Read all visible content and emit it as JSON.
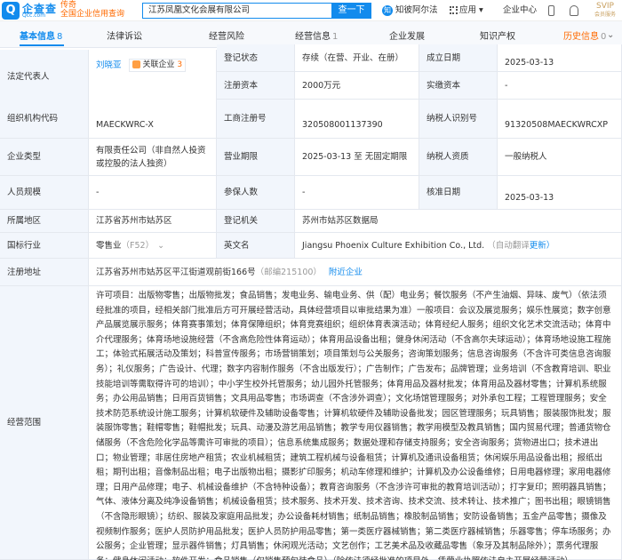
{
  "header": {
    "logo_char": "Q",
    "logo_cn": "企查查",
    "logo_en": "Qcc.com",
    "slogan_line1": "传奇",
    "slogan_line2": "全国企业信用查询",
    "search_value": "江苏凤凰文化会展有限公司",
    "search_button": "查一下",
    "zhibi_label": "知彼阿尔法",
    "apps_label": "应用",
    "center_label": "企业中心",
    "svip_label": "SVIP",
    "svip_sub": "会员服务"
  },
  "tabs": [
    {
      "label": "基本信息",
      "count": "8"
    },
    {
      "label": "法律诉讼",
      "count": ""
    },
    {
      "label": "经营风险",
      "count": ""
    },
    {
      "label": "经营信息",
      "count": "1"
    },
    {
      "label": "企业发展",
      "count": ""
    },
    {
      "label": "知识产权",
      "count": ""
    },
    {
      "label": "历史信息",
      "count": "0"
    }
  ],
  "info": {
    "legal_rep_label": "法定代表人",
    "legal_rep_name": "刘晓亚",
    "related_label": "关联企业",
    "related_count": "3",
    "reg_status_label": "登记状态",
    "reg_status_value": "存续（在营、开业、在册）",
    "est_date_label": "成立日期",
    "est_date_value": "2025-03-13",
    "reg_capital_label": "注册资本",
    "reg_capital_value": "2000万元",
    "paid_capital_label": "实缴资本",
    "paid_capital_value": "-",
    "org_code_label": "组织机构代码",
    "org_code_value": "MAECKWRC-X",
    "biz_reg_no_label": "工商注册号",
    "biz_reg_no_value": "320508001137390",
    "taxpayer_id_label": "纳税人识别号",
    "taxpayer_id_value": "91320508MAECKWRCXP",
    "ent_type_label": "企业类型",
    "ent_type_value": "有限责任公司（非自然人投资或控股的法人独资）",
    "biz_term_label": "营业期限",
    "biz_term_value": "2025-03-13 至 无固定期限",
    "taxpayer_qual_label": "纳税人资质",
    "taxpayer_qual_value": "一般纳税人",
    "staff_size_label": "人员规模",
    "staff_size_value": "-",
    "insured_label": "参保人数",
    "insured_value": "-",
    "approval_date_label": "核准日期",
    "approval_date_value": "2025-03-13",
    "region_label": "所属地区",
    "region_value": "江苏省苏州市姑苏区",
    "reg_authority_label": "登记机关",
    "reg_authority_value": "苏州市姑苏区数据局",
    "industry_label": "国标行业",
    "industry_value": "零售业",
    "industry_code": "（F52）",
    "en_name_label": "英文名",
    "en_name_value": "Jiangsu Phoenix Culture Exhibition Co., Ltd.",
    "auto_translate": "（自动翻译",
    "update_link": "更新）",
    "address_label": "注册地址",
    "address_value": "江苏省苏州市姑苏区平江街道观前街166号",
    "postcode": "（邮编215100）",
    "nearby_link": "附近企业",
    "scope_label": "经营范围",
    "scope_value": "许可项目：出版物零售；出版物批发；食品销售；发电业务、输电业务、供（配）电业务；餐饮服务（不产生油烟、异味、废气）（依法须经批准的项目，经相关部门批准后方可开展经营活动，具体经营项目以审批结果为准）一般项目：会议及展览服务；娱乐性展览；数字创意产品展览展示服务；体育赛事策划；体育保障组织；体育竞赛组织；组织体育表演活动；体育经纪人服务；组织文化艺术交流活动；体育中介代理服务；体育场地设施经营（不含高危险性体育运动）；体育用品设备出租；健身休闲活动（不含高尔夫球运动）；体育场地设施工程施工；体验式拓展活动及策划；科普宣传服务；市场营销策划；项目策划与公关服务；咨询策划服务；信息咨询服务（不含许可类信息咨询服务）；礼仪服务；广告设计、代理；数字内容制作服务（不含出版发行）；广告制作；广告发布；品牌管理；业务培训（不含教育培训、职业技能培训等需取得许可的培训）；中小学生校外托管服务；幼儿园外托管服务；体育用品及器材批发；体育用品及器材零售；计算机系统服务；办公用品销售；日用百货销售；文具用品零售；市场调查（不含涉外调查）；文化场馆管理服务；对外承包工程；工程管理服务；安全技术防范系统设计施工服务；计算机软硬件及辅助设备零售；计算机软硬件及辅助设备批发；园区管理服务；玩具销售；服装服饰批发；服装服饰零售；鞋帽零售；鞋帽批发；玩具、动漫及游艺用品销售；教学专用仪器销售；教学用模型及教具销售；国内贸易代理；普通货物仓储服务（不含危险化学品等需许可审批的项目）；信息系统集成服务；数据处理和存储支持服务；安全咨询服务；货物进出口；技术进出口；物业管理；非居住房地产租赁；农业机械租赁；建筑工程机械与设备租赁；计算机及通讯设备租赁；休闲娱乐用品设备出租；报纸出租；期刊出租；音像制品出租；电子出版物出租；摄影扩印服务；机动车修理和维护；计算机及办公设备维修；日用电器修理；家用电器修理；日用产品修理；电子、机械设备维护（不含特种设备）；教育咨询服务（不含涉许可审批的教育培训活动）；打字复印；照明器具销售；气体、液体分离及纯净设备销售；机械设备租赁；技术服务、技术开发、技术咨询、技术交流、技术转让、技术推广；图书出租；眼镜销售（不含隐形眼镜）；纺织、服装及家庭用品批发；办公设备耗材销售；纸制品销售；橡胶制品销售；安防设备销售；五金产品零售；摄像及视频制作服务；医护人员防护用品批发；医护人员防护用品零售；第一类医疗器械销售；第二类医疗器械销售；乐器零售；停车场服务；办公服务；企业管理；显示器件销售；灯具销售；休闲观光活动；文艺创作；工艺美术品及收藏品零售（象牙及其制品除外）；票务代理服务；健身休闲活动；软件开发；食品销售（仅销售预包装食品）（除依法须经批准的项目外，凭营业执照依法自主开展经营活动）"
  },
  "colors": {
    "accent": "#128bed",
    "label_bg": "#f2f6fc",
    "history": "#ff6a00"
  }
}
